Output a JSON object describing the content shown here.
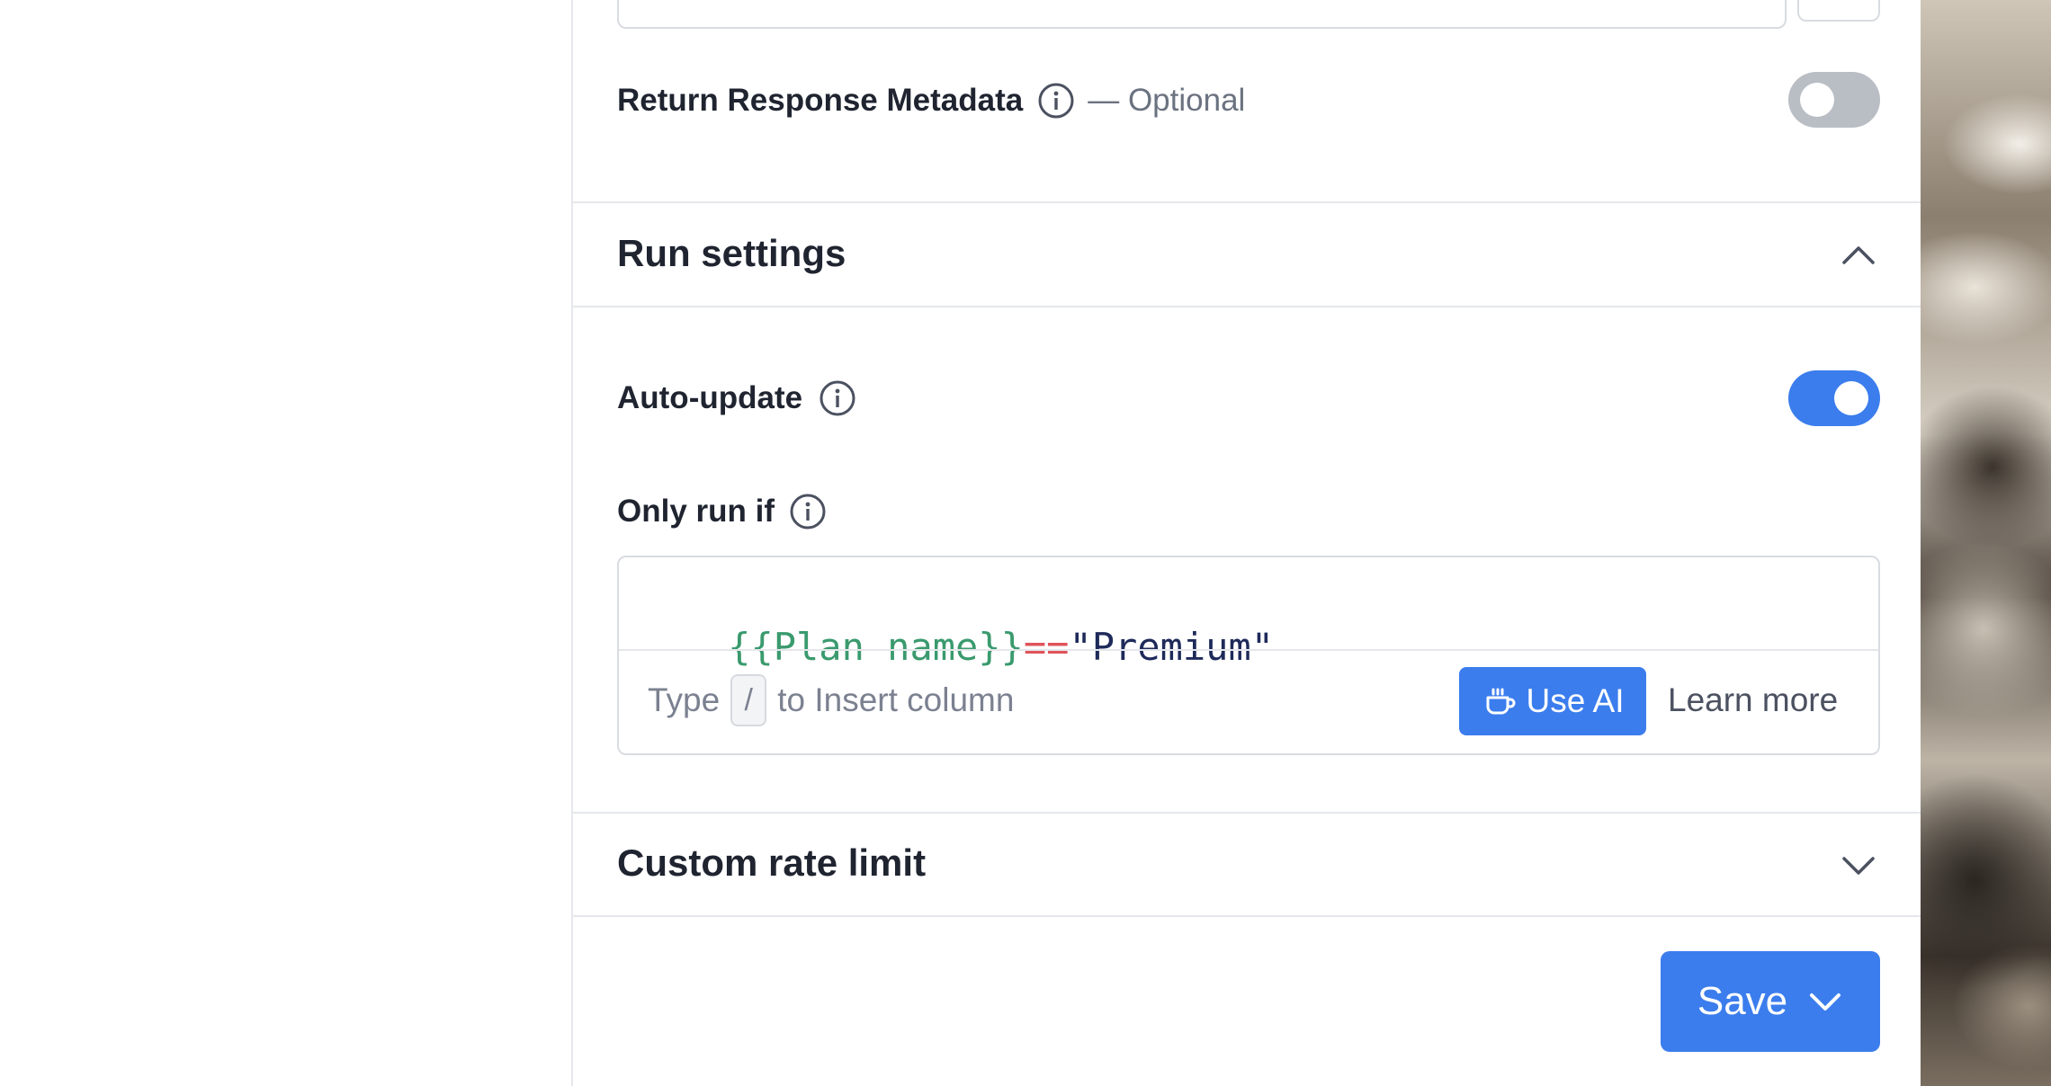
{
  "metadata_row": {
    "label": "Return Response Metadata",
    "suffix": "— Optional",
    "toggle_on": false
  },
  "run_settings": {
    "title": "Run settings",
    "expanded": true,
    "auto_update": {
      "label": "Auto-update",
      "toggle_on": true
    },
    "only_run_if": {
      "label": "Only run if",
      "expression": {
        "variable": "{{Plan name}}",
        "operator": "==",
        "value": "\"Premium\""
      },
      "hint_prefix": "Type",
      "hint_key": "/",
      "hint_suffix": "to Insert column",
      "use_ai_label": "Use AI",
      "learn_more_label": "Learn more"
    }
  },
  "custom_rate_limit": {
    "title": "Custom rate limit",
    "expanded": false
  },
  "save_button": {
    "label": "Save"
  },
  "colors": {
    "accent": "#3b7ded",
    "toggle_off": "#b9bdc4",
    "code_variable": "#3a9a6e",
    "code_operator": "#e0535a",
    "code_string": "#1e2a5a"
  },
  "icons": {
    "info": "info-circle-icon",
    "collapse": "chevron-up-icon",
    "expand": "chevron-down-icon",
    "ai": "coffee-cup-icon"
  }
}
